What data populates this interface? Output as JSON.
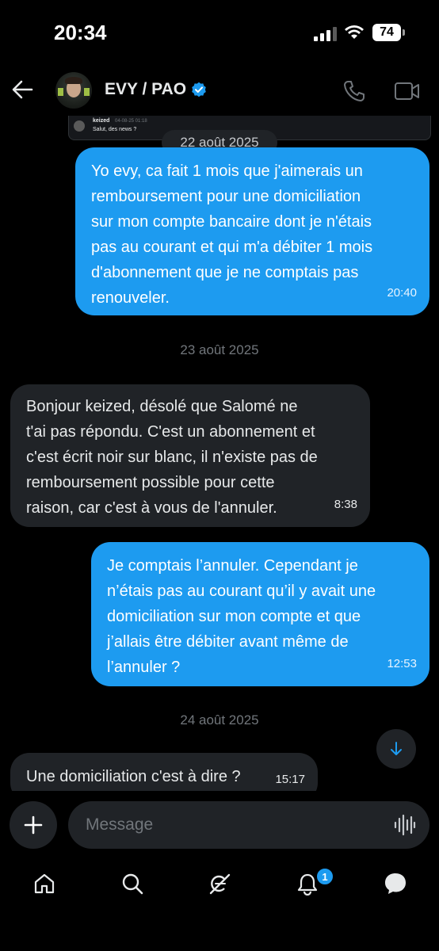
{
  "status": {
    "time": "20:34",
    "battery": "74"
  },
  "header": {
    "title": "EVY / PAO"
  },
  "quote_preview": {
    "name": "keized",
    "date": "04-08-25 01:18",
    "text": "Salut, des news ?"
  },
  "messages": [
    {
      "type": "date_pill",
      "text": "22 août 2025"
    },
    {
      "type": "outgoing",
      "text": "Yo evy, ca fait 1 mois que j'aimerais un\nremboursement pour une domiciliation\nsur mon compte bancaire dont je n'étais\npas au courant et qui m'a débiter 1 mois\nd'abonnement que je ne comptais pas\nrenouveler.",
      "time": "20:40"
    },
    {
      "type": "date",
      "text": "23 août 2025"
    },
    {
      "type": "incoming",
      "text": "Bonjour keized, désolé que Salomé ne\nt'ai pas répondu. C'est un abonnement et\nc'est écrit noir sur blanc, il n'existe pas de\nremboursement possible pour cette\nraison, car c'est à vous de l'annuler.",
      "time": "8:38"
    },
    {
      "type": "outgoing",
      "text": "Je comptais l’annuler. Cependant je\nn’étais pas au courant qu’il y avait une\ndomiciliation sur mon compte et que\nj’allais être débiter avant même de\nl’annuler ?",
      "time": "12:53"
    },
    {
      "type": "date",
      "text": "24 août 2025"
    },
    {
      "type": "incoming",
      "text": "Une domiciliation c'est à dire ?",
      "time": "15:17"
    }
  ],
  "composer": {
    "placeholder": "Message"
  },
  "tabbar": {
    "notifications_badge": "1"
  },
  "colors": {
    "accent": "#1d9bf0",
    "background": "#000000",
    "bubble_incoming": "#202327",
    "verified": "#1d9bf0"
  },
  "icons": [
    "back-arrow-icon",
    "verified-icon",
    "phone-icon",
    "video-icon",
    "plus-icon",
    "voice-wave-icon",
    "home-icon",
    "search-icon",
    "grok-icon",
    "bell-icon",
    "messages-icon",
    "arrow-down-icon"
  ]
}
